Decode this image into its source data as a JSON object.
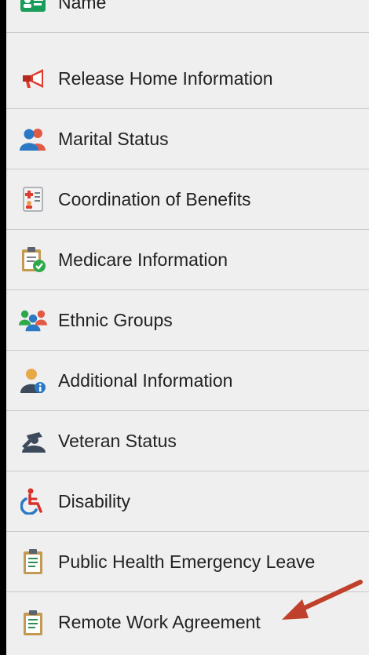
{
  "menu": {
    "items": [
      {
        "label": "Name",
        "icon": "name-card-icon"
      },
      {
        "label": "Release Home Information",
        "icon": "megaphone-icon"
      },
      {
        "label": "Marital Status",
        "icon": "couple-icon"
      },
      {
        "label": "Coordination of Benefits",
        "icon": "benefits-document-icon"
      },
      {
        "label": "Medicare Information",
        "icon": "clipboard-check-icon"
      },
      {
        "label": "Ethnic Groups",
        "icon": "group-people-icon"
      },
      {
        "label": "Additional Information",
        "icon": "person-info-icon"
      },
      {
        "label": "Veteran Status",
        "icon": "veteran-salute-icon"
      },
      {
        "label": "Disability",
        "icon": "wheelchair-icon"
      },
      {
        "label": "Public Health Emergency Leave",
        "icon": "clipboard-icon"
      },
      {
        "label": "Remote Work Agreement",
        "icon": "clipboard-icon"
      }
    ]
  },
  "annotation": {
    "arrow_color": "#c0412b",
    "points_to": "Remote Work Agreement"
  }
}
